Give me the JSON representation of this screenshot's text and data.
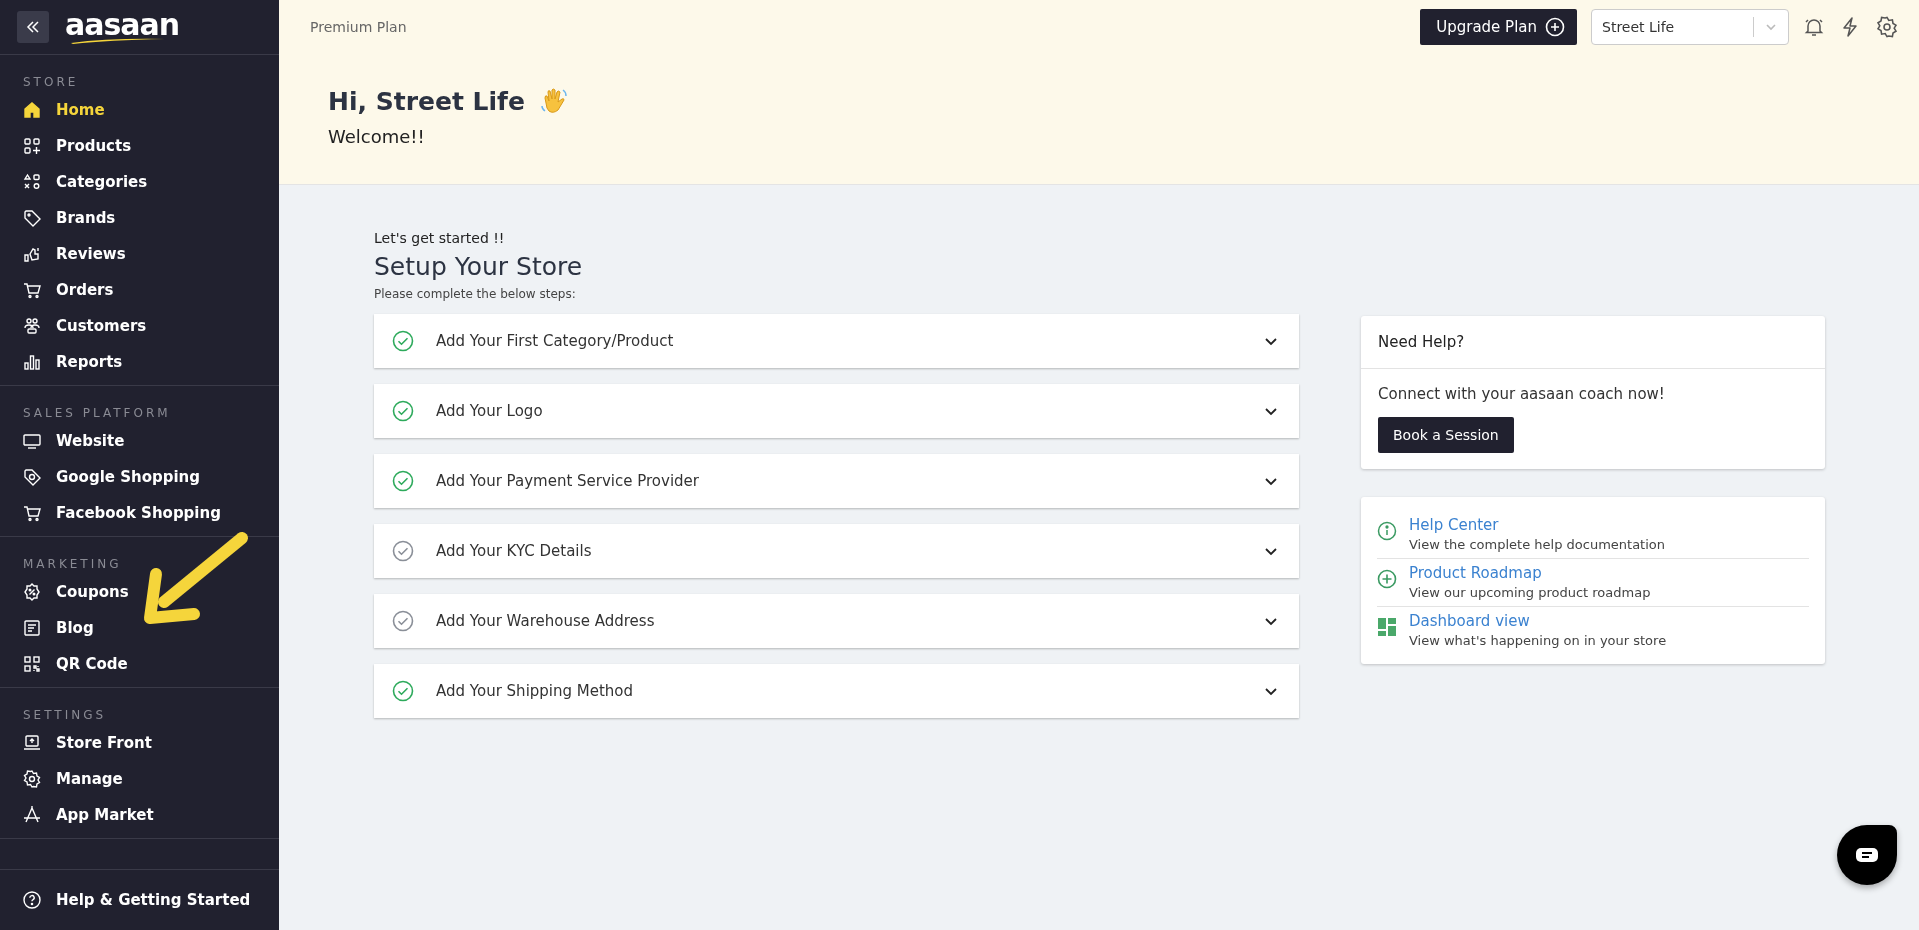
{
  "sidebar": {
    "logo": "aasaan",
    "sections": [
      {
        "label": "STORE",
        "items": [
          {
            "label": "Home",
            "selected": true
          },
          {
            "label": "Products",
            "selected": false
          },
          {
            "label": "Categories",
            "selected": false
          },
          {
            "label": "Brands",
            "selected": false
          },
          {
            "label": "Reviews",
            "selected": false
          },
          {
            "label": "Orders",
            "selected": false
          },
          {
            "label": "Customers",
            "selected": false
          },
          {
            "label": "Reports",
            "selected": false
          }
        ]
      },
      {
        "label": "SALES PLATFORM",
        "items": [
          {
            "label": "Website",
            "selected": false
          },
          {
            "label": "Google Shopping",
            "selected": false
          },
          {
            "label": "Facebook Shopping",
            "selected": false
          }
        ]
      },
      {
        "label": "MARKETING",
        "items": [
          {
            "label": "Coupons",
            "selected": false
          },
          {
            "label": "Blog",
            "selected": false
          },
          {
            "label": "QR Code",
            "selected": false
          }
        ]
      },
      {
        "label": "SETTINGS",
        "items": [
          {
            "label": "Store Front",
            "selected": false
          },
          {
            "label": "Manage",
            "selected": false
          },
          {
            "label": "App Market",
            "selected": false
          }
        ]
      }
    ],
    "footer_item": {
      "label": "Help & Getting Started"
    }
  },
  "topbar": {
    "plan": "Premium Plan",
    "upgrade_button": "Upgrade Plan",
    "store_select": "Street Life"
  },
  "greeting": {
    "title": "Hi, Street Life",
    "subtitle": "Welcome!!"
  },
  "setup": {
    "kicker": "Let's get started !!",
    "title": "Setup Your Store",
    "hint": "Please complete the below steps:",
    "steps": [
      {
        "label": "Add Your First Category/Product",
        "done": true
      },
      {
        "label": "Add Your Logo",
        "done": true
      },
      {
        "label": "Add Your Payment Service Provider",
        "done": true
      },
      {
        "label": "Add Your KYC Details",
        "done": false
      },
      {
        "label": "Add Your Warehouse Address",
        "done": false
      },
      {
        "label": "Add Your Shipping Method",
        "done": true
      }
    ]
  },
  "help_card": {
    "title": "Need Help?",
    "text": "Connect with your aasaan coach now!",
    "button": "Book a Session"
  },
  "links": [
    {
      "title": "Help Center",
      "description": "View the complete help documentation"
    },
    {
      "title": "Product Roadmap",
      "description": "View our upcoming product roadmap"
    },
    {
      "title": "Dashboard view",
      "description": "View what's happening on in your store"
    }
  ]
}
